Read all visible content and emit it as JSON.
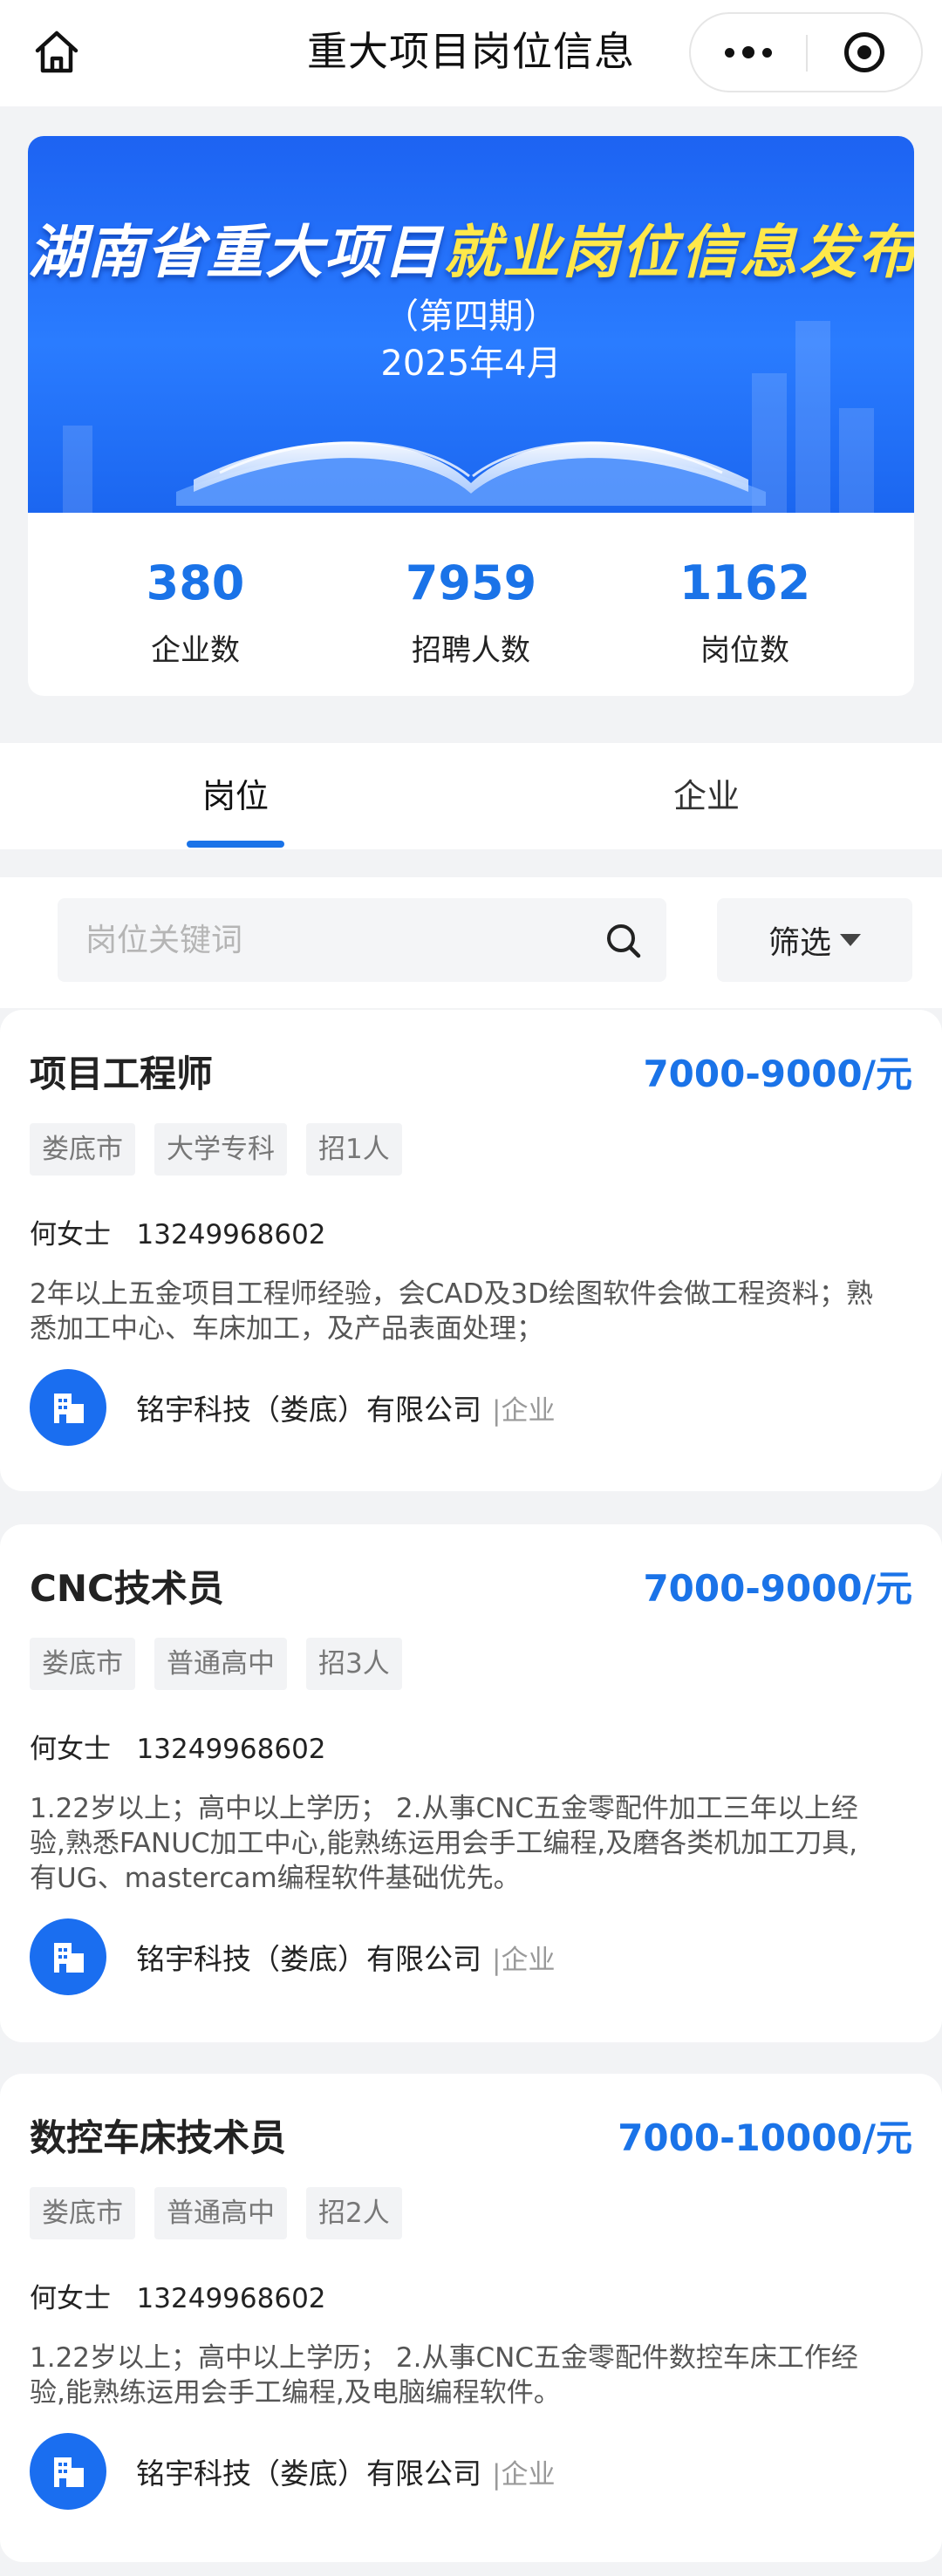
{
  "nav": {
    "title": "重大项目岗位信息"
  },
  "banner": {
    "title_white": "湖南省重大项目",
    "title_yellow": "就业岗位信息发布",
    "issue": "（第四期）",
    "date": "2025年4月"
  },
  "stats": [
    {
      "value": "380",
      "label": "企业数"
    },
    {
      "value": "7959",
      "label": "招聘人数"
    },
    {
      "value": "1162",
      "label": "岗位数"
    }
  ],
  "tabs": [
    {
      "label": "岗位",
      "active": true
    },
    {
      "label": "企业",
      "active": false
    }
  ],
  "search": {
    "placeholder": "岗位关键词",
    "value": "",
    "filter_label": "筛选"
  },
  "jobs": [
    {
      "title": "项目工程师",
      "salary": "7000-9000/元",
      "tags": [
        "娄底市",
        "大学专科",
        "招1人"
      ],
      "contact": "何女士   13249968602",
      "description": "2年以上五金项目工程师经验，会CAD及3D绘图软件会做工程资料；熟悉加工中心、车床加工，及产品表面处理；",
      "company": "铭宇科技（娄底）有限公司",
      "company_type": "|企业"
    },
    {
      "title": "CNC技术员",
      "salary": "7000-9000/元",
      "tags": [
        "娄底市",
        "普通高中",
        "招3人"
      ],
      "contact": "何女士   13249968602",
      "description": "1.22岁以上；高中以上学历；  2.从事CNC五金零配件加工三年以上经验,熟悉FANUC加工中心,能熟练运用会手工编程,及磨各类机加工刀具,有UG、mastercam编程软件基础优先。",
      "company": "铭宇科技（娄底）有限公司",
      "company_type": "|企业"
    },
    {
      "title": "数控车床技术员",
      "salary": "7000-10000/元",
      "tags": [
        "娄底市",
        "普通高中",
        "招2人"
      ],
      "contact": "何女士   13249968602",
      "description": "1.22岁以上；高中以上学历；  2.从事CNC五金零配件数控车床工作经验,能熟练运用会手工编程,及电脑编程软件。",
      "company": "铭宇科技（娄底）有限公司",
      "company_type": "|企业"
    }
  ],
  "colors": {
    "accent": "#1a73e8",
    "banner_blue": "#2a7cff",
    "banner_yellow": "#ffe84a"
  },
  "icons": [
    "home-icon",
    "more-icon",
    "close-mini-program-icon",
    "search-icon",
    "caret-down-icon",
    "building-icon"
  ]
}
